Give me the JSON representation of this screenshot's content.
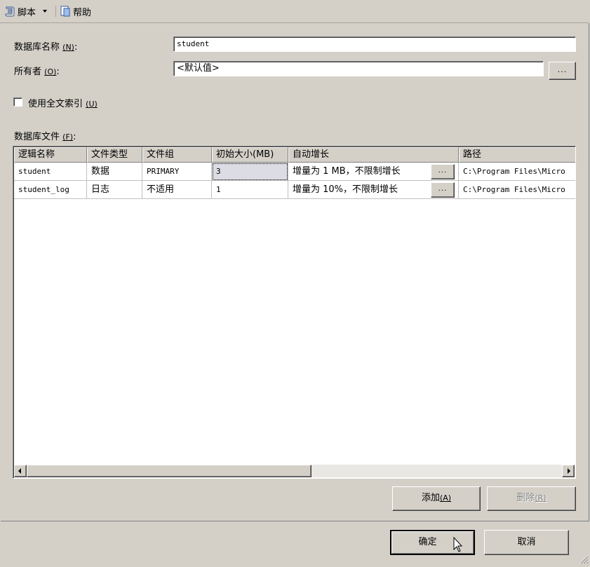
{
  "toolbar": {
    "script_label": "脚本",
    "help_label": "帮助",
    "script_icon": "script-icon",
    "help_icon": "help-icon"
  },
  "form": {
    "db_name_label": "数据库名称",
    "db_name_key": "(N)",
    "db_name_value": "student",
    "owner_label": "所有者",
    "owner_key": "(O)",
    "owner_value": "<默认值>",
    "owner_browse": "...",
    "fulltext_label": "使用全文索引",
    "fulltext_key": "(U)",
    "fulltext_checked": false,
    "files_label": "数据库文件",
    "files_key": "(F)"
  },
  "grid": {
    "columns": [
      "逻辑名称",
      "文件类型",
      "文件组",
      "初始大小(MB)",
      "自动增长",
      "路径"
    ],
    "rows": [
      {
        "name": "student",
        "type": "数据",
        "filegroup": "PRIMARY",
        "size": "3",
        "growth": "增量为 1 MB，不限制增长",
        "path": "C:\\Program Files\\Micro"
      },
      {
        "name": "student_log",
        "type": "日志",
        "filegroup": "不适用",
        "size": "1",
        "growth": "增量为 10%，不限制增长",
        "path": "C:\\Program Files\\Micro"
      }
    ],
    "ellipsis": "..."
  },
  "buttons": {
    "add": "添加",
    "add_key": "(A)",
    "remove": "删除",
    "remove_key": "(R)",
    "ok": "确定",
    "cancel": "取消"
  },
  "colors": {
    "window_bg": "#d4d0c8",
    "selected_cell": "#dcdce4",
    "disabled_text": "#808080"
  }
}
